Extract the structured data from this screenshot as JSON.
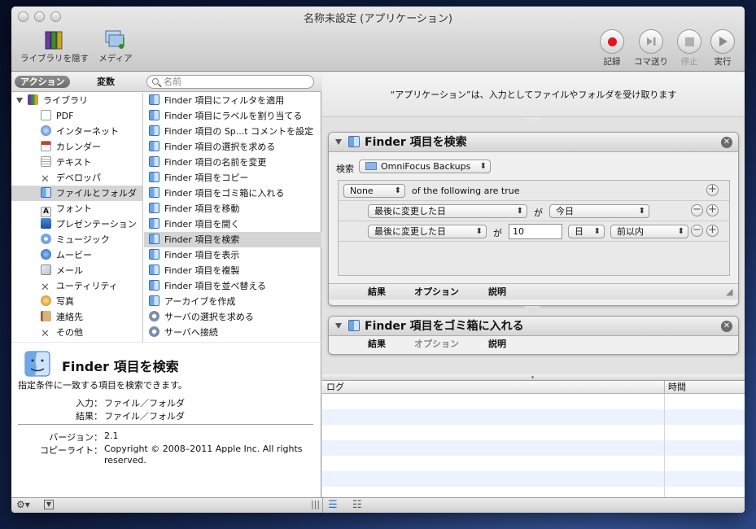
{
  "window": {
    "title": "名称未設定 (アプリケーション)"
  },
  "toolbar": {
    "hide_library": "ライブラリを隠す",
    "media": "メディア",
    "record": "記録",
    "step": "コマ送り",
    "stop": "停止",
    "run": "実行"
  },
  "library": {
    "tab_actions": "アクション",
    "tab_variables": "変数",
    "search_placeholder": "名前",
    "root": "ライブラリ",
    "items": [
      "PDF",
      "インターネット",
      "カレンダー",
      "テキスト",
      "デベロッパ",
      "ファイルとフォルダ",
      "フォント",
      "プレゼンテーション",
      "ミュージック",
      "ムービー",
      "メール",
      "ユーティリティ",
      "写真",
      "連絡先",
      "その他"
    ],
    "selected": "ファイルとフォルダ"
  },
  "actions": {
    "items": [
      "Finder 項目にフィルタを適用",
      "Finder 項目にラベルを割り当てる",
      "Finder 項目の Sp...t コメントを設定",
      "Finder 項目の選択を求める",
      "Finder 項目の名前を変更",
      "Finder 項目をコピー",
      "Finder 項目をゴミ箱に入れる",
      "Finder 項目を移動",
      "Finder 項目を開く",
      "Finder 項目を検索",
      "Finder 項目を表示",
      "Finder 項目を複製",
      "Finder 項目を並べ替える",
      "アーカイブを作成",
      "サーバの選択を求める",
      "サーバへ接続"
    ],
    "selected": "Finder 項目を検索"
  },
  "description": {
    "title": "Finder 項目を検索",
    "summary": "指定条件に一致する項目を検索できます。",
    "input_label": "入力：",
    "input_value": "ファイル／フォルダ",
    "result_label": "結果：",
    "result_value": "ファイル／フォルダ",
    "version_label": "バージョン：",
    "version_value": "2.1",
    "copyright_label": "コピーライト：",
    "copyright_value": "Copyright © 2008–2011 Apple Inc.  All rights reserved."
  },
  "workflow": {
    "hint": "“アプリケーション”は、入力としてファイルやフォルダを受け取ります",
    "block1": {
      "title": "Finder 項目を検索",
      "search_label": "検索",
      "search_location": "OmniFocus Backups",
      "match": "None",
      "match_suffix": "of the following are true",
      "cond1_attr": "最後に変更した日",
      "cond1_op": "が",
      "cond1_value": "今日",
      "cond2_attr": "最後に変更した日",
      "cond2_op": "が",
      "cond2_number": "10",
      "cond2_unit": "日",
      "cond2_range": "前以内",
      "tab_results": "結果",
      "tab_options": "オプション",
      "tab_description": "説明"
    },
    "block2": {
      "title": "Finder 項目をゴミ箱に入れる",
      "tab_results": "結果",
      "tab_options": "オプション",
      "tab_description": "説明"
    }
  },
  "log": {
    "col_log": "ログ",
    "col_time": "時間"
  },
  "colors": {
    "record": "#e8121c",
    "selection": "#d5d5d5",
    "log_alt": "#edf3fe"
  }
}
